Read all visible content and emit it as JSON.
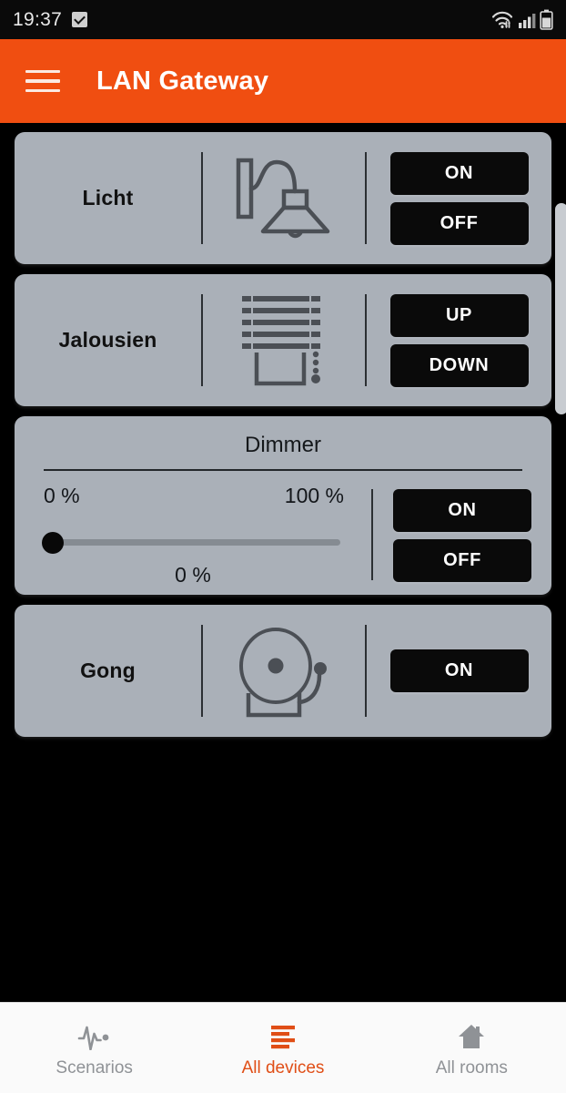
{
  "status_bar": {
    "time": "19:37",
    "icons": [
      "checkbox-checked-icon",
      "wifi-icon",
      "cell-signal-icon",
      "battery-icon"
    ]
  },
  "app_bar": {
    "menu_icon": "hamburger-menu-icon",
    "title": "LAN Gateway",
    "accent_color": "#f04e11"
  },
  "cards": [
    {
      "name": "Licht",
      "icon": "wall-lamp-icon",
      "buttons": [
        {
          "label": "ON"
        },
        {
          "label": "OFF"
        }
      ]
    },
    {
      "name": "Jalousien",
      "icon": "window-blinds-icon",
      "buttons": [
        {
          "label": "UP"
        },
        {
          "label": "DOWN"
        }
      ]
    },
    {
      "name": "Gong",
      "icon": "gong-bell-icon",
      "buttons": [
        {
          "label": "ON"
        }
      ]
    }
  ],
  "dimmer": {
    "title": "Dimmer",
    "min_label": "0 %",
    "max_label": "100 %",
    "current_value_label": "0 %",
    "slider_percent": 0,
    "buttons": [
      {
        "label": "ON"
      },
      {
        "label": "OFF"
      }
    ]
  },
  "bottom_nav": {
    "items": [
      {
        "label": "Scenarios",
        "icon": "pulse-activity-icon",
        "active": false
      },
      {
        "label": "All devices",
        "icon": "list-lines-icon",
        "active": true
      },
      {
        "label": "All rooms",
        "icon": "house-icon",
        "active": false
      }
    ],
    "active_color": "#e04e16",
    "inactive_color": "#8f9296"
  },
  "theme": {
    "page_background": "#000000",
    "card_background": "#aab0b8",
    "button_background": "#0a0a0a",
    "button_text": "#ffffff"
  }
}
